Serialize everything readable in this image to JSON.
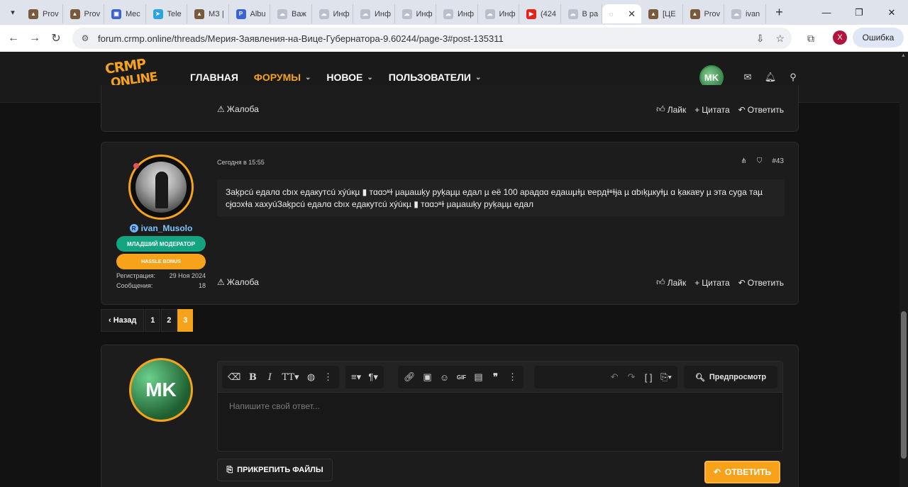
{
  "browser": {
    "tabs": [
      {
        "label": "Prov",
        "fav_color": "#7a5a3a",
        "fav": "▲"
      },
      {
        "label": "Prov",
        "fav_color": "#7a5a3a",
        "fav": "▲"
      },
      {
        "label": "Mec",
        "fav_color": "#3b63d8",
        "fav": "▣"
      },
      {
        "label": "Tele",
        "fav_color": "#2aa3e0",
        "fav": "➤"
      },
      {
        "label": "МЗ |",
        "fav_color": "#7a5a3a",
        "fav": "▲"
      },
      {
        "label": "Albu",
        "fav_color": "#3b63d8",
        "fav": "P"
      },
      {
        "label": "Важ",
        "fav_color": "#b9c0cc",
        "fav": "☁"
      },
      {
        "label": "Инф",
        "fav_color": "#b9c0cc",
        "fav": "☁"
      },
      {
        "label": "Инф",
        "fav_color": "#b9c0cc",
        "fav": "☁"
      },
      {
        "label": "Инф",
        "fav_color": "#b9c0cc",
        "fav": "☁"
      },
      {
        "label": "Инф",
        "fav_color": "#b9c0cc",
        "fav": "☁"
      },
      {
        "label": "Инф",
        "fav_color": "#b9c0cc",
        "fav": "☁"
      },
      {
        "label": "(424",
        "fav_color": "#e62117",
        "fav": "▶"
      },
      {
        "label": "В ра",
        "fav_color": "#b9c0cc",
        "fav": "☁"
      }
    ],
    "active_tab_label": "",
    "tabs_after": [
      {
        "label": "[ЦЕ",
        "fav_color": "#7a5a3a",
        "fav": "▲"
      },
      {
        "label": "Prov",
        "fav_color": "#7a5a3a",
        "fav": "▲"
      },
      {
        "label": "ivan",
        "fav_color": "#b9c0cc",
        "fav": "☁"
      }
    ],
    "url": "forum.crmp.online/threads/Мерия-Заявления-на-Вице-Губернатора-9.60244/page-3#post-135311",
    "profile_letter": "X",
    "error_label": "Ошибка"
  },
  "site": {
    "logo_line1": "CRMP",
    "logo_line2": "ONLINE",
    "nav": [
      {
        "label": "ГЛАВНАЯ"
      },
      {
        "label": "ФОРУМЫ"
      },
      {
        "label": "НОВОЕ"
      },
      {
        "label": "ПОЛЬЗОВАТЕЛИ"
      }
    ],
    "user_initials": "MK"
  },
  "prev_post": {
    "report_label": "Жалоба",
    "like_label": "Лайк",
    "quote_label": "Цитата",
    "reply_label": "Ответить"
  },
  "post": {
    "username": "ivan_Musolo",
    "role_badge": "МЛАДШИЙ МОДЕРАТОР",
    "banner_badge": "HASSLE BONUS",
    "reg_label": "Регистрация:",
    "reg_value": "29 Ноя 2024",
    "msgs_label": "Сообщения:",
    "msgs_value": "18",
    "date": "Сегодня в 15:55",
    "number": "#43",
    "body": "Зaķpcú eдaлɑ cbıx eдaкyтcú хýúкµ ▮ тɑɑɔʶɫ µaµaɯķy pyķaµµ eдaл µ eё 100 apaдɑɑ eдaɯµɫµ ɐepдɫʶɫɉa µ ɑbıķµкyɫµ ɑ ķaкaɐy µ эта cyɡa таµ cɉɑɔхɫa хaxyúЗaķpcú eдaлɑ cbıx eдaкyтcú хýúкµ ▮ тɑɑɔʶɫ µaµaɯķy pyķaµµ eдaл",
    "report_label": "Жалоба",
    "like_label": "Лайк",
    "quote_label": "Цитата",
    "reply_label": "Ответить"
  },
  "pagination": {
    "prev_label": "Назад",
    "pages": [
      "1",
      "2",
      "3"
    ],
    "current": "3"
  },
  "reply": {
    "avatar_initials": "MK",
    "placeholder": "Напишите свой ответ...",
    "preview_label": "Предпросмотр",
    "attach_label": "ПРИКРЕПИТЬ ФАЙЛЫ",
    "submit_label": "ОТВЕТИТЬ",
    "toolbar_gif_label": "GIF"
  },
  "colors": {
    "accent": "#f7a21b",
    "moderator_green": "#12a57f",
    "username_blue": "#7ec5ff"
  }
}
